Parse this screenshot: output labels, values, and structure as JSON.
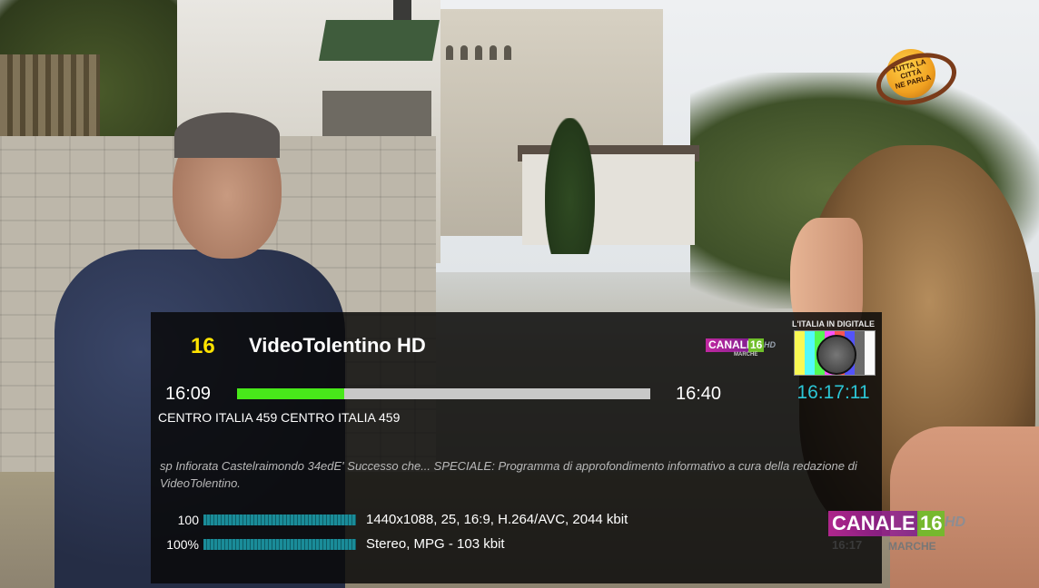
{
  "top_logo": {
    "line1": "TUTTA LA CITTÀ",
    "line2": "NE PARLA"
  },
  "channel": {
    "number": "16",
    "name": "VideoTolentino HD",
    "provider_logo": {
      "name": "CANALE",
      "number": "16",
      "hd": "HD",
      "region": "MARCHE"
    },
    "digitale_label": "L'ITALIA IN DIGITALE"
  },
  "event": {
    "start_time": "16:09",
    "end_time": "16:40",
    "progress": 0.26,
    "current_clock": "16:17:11",
    "title": "CENTRO ITALIA 459 CENTRO ITALIA 459",
    "description": "sp Infiorata Castelraimondo 34edE' Successo che... SPECIALE:  Programma di approfondimento informativo a cura della redazione di VideoTolentino."
  },
  "signal": {
    "video": {
      "level_label": "100",
      "level": 1.0,
      "info": "1440x1088, 25, 16:9, H.264/AVC, 2044 kbit"
    },
    "audio": {
      "level_label": "100%",
      "level": 1.0,
      "info": "Stereo, MPG - 103 kbit"
    }
  },
  "watermark": {
    "name": "CANALE",
    "number": "16",
    "hd": "HD",
    "time": "16:17",
    "region": "MARCHE"
  },
  "colors": {
    "channel_number": "#ffe300",
    "progress_fill": "#48e81a",
    "clock": "#2cc6d6",
    "signal_bar": "#1a8c99"
  }
}
